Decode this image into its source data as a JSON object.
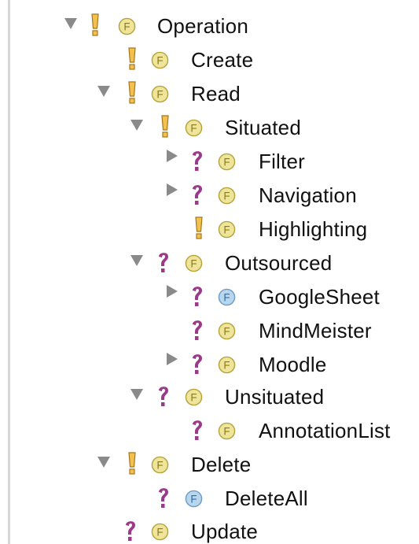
{
  "tree": {
    "nodes": [
      {
        "label": "Operation",
        "mark": "mandatory",
        "icon": "feature",
        "twisty": "expanded"
      },
      {
        "label": "Create",
        "mark": "mandatory",
        "icon": "feature",
        "twisty": "none"
      },
      {
        "label": "Read",
        "mark": "mandatory",
        "icon": "feature",
        "twisty": "expanded"
      },
      {
        "label": "Situated",
        "mark": "mandatory",
        "icon": "feature",
        "twisty": "expanded"
      },
      {
        "label": "Filter",
        "mark": "optional",
        "icon": "feature",
        "twisty": "collapsed"
      },
      {
        "label": "Navigation",
        "mark": "optional",
        "icon": "feature",
        "twisty": "collapsed"
      },
      {
        "label": "Highlighting",
        "mark": "mandatory",
        "icon": "feature",
        "twisty": "none"
      },
      {
        "label": "Outsourced",
        "mark": "optional",
        "icon": "feature",
        "twisty": "expanded"
      },
      {
        "label": "GoogleSheet",
        "mark": "optional",
        "icon": "feature-concrete",
        "twisty": "collapsed"
      },
      {
        "label": "MindMeister",
        "mark": "optional",
        "icon": "feature",
        "twisty": "none"
      },
      {
        "label": "Moodle",
        "mark": "optional",
        "icon": "feature",
        "twisty": "collapsed"
      },
      {
        "label": "Unsituated",
        "mark": "optional",
        "icon": "feature",
        "twisty": "expanded"
      },
      {
        "label": "AnnotationList",
        "mark": "optional",
        "icon": "feature",
        "twisty": "none"
      },
      {
        "label": "Delete",
        "mark": "mandatory",
        "icon": "feature",
        "twisty": "expanded"
      },
      {
        "label": "DeleteAll",
        "mark": "optional",
        "icon": "feature-concrete",
        "twisty": "none"
      },
      {
        "label": "Update",
        "mark": "optional",
        "icon": "feature",
        "twisty": "none"
      }
    ]
  },
  "icons": {
    "feature_letter": "F",
    "mandatory_icon": "exclamation-icon",
    "optional_icon": "question-icon",
    "expanded_icon": "triangle-down-icon",
    "collapsed_icon": "triangle-right-icon"
  },
  "colors": {
    "feature_fill": "#efe59a",
    "feature_stroke": "#b5a23a",
    "feature_letter": "#8a7a1c",
    "concrete_fill": "#b8d6ee",
    "concrete_stroke": "#6d9cc4",
    "concrete_letter": "#2f6da3",
    "mandatory_fill": "#f2c14e",
    "mandatory_stroke": "#a6761d",
    "optional_fill": "#9b3a8a",
    "twisty": "#8a8a8a"
  }
}
